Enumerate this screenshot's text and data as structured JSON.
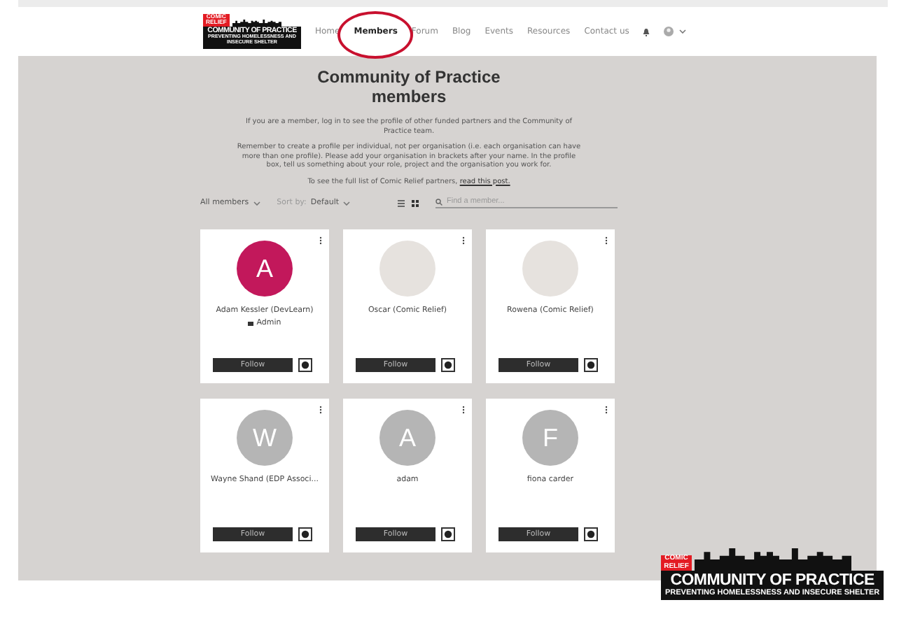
{
  "header": {
    "logo": {
      "badge": "COMIC RELIEF",
      "title": "COMMUNITY OF PRACTICE",
      "subtitle": "PREVENTING HOMELESSNESS AND INSECURE SHELTER"
    },
    "nav": [
      {
        "label": "Home",
        "selected": false
      },
      {
        "label": "Members",
        "selected": true
      },
      {
        "label": "Forum",
        "selected": false
      },
      {
        "label": "Blog",
        "selected": false
      },
      {
        "label": "Events",
        "selected": false
      },
      {
        "label": "Resources",
        "selected": false
      },
      {
        "label": "Contact us",
        "selected": false
      }
    ]
  },
  "content": {
    "title": "Community of Practice members",
    "paragraphs": [
      "If you are a member, log in to see the profile of other funded partners and the Community of Practice team.",
      "Remember to create a profile per individual, not per organisation (i.e. each organisation can have more than one profile). Please add your organisation in brackets after your name. In the profile box, tell us something about your role, project and the organisation you work for."
    ],
    "link_sentence": "To see the full list of Comic Relief partners,",
    "link": "read this post.",
    "filter": "All members",
    "sort_label": "Sort by:",
    "sort_value": "Default",
    "search": {
      "placeholder": "Find a member..."
    },
    "members": [
      {
        "name": "Adam Kessler (DevLearn)",
        "role": "Admin",
        "avatar": {
          "kind": "initial",
          "letter": "A",
          "color": "#c2185b"
        },
        "follow": "Follow"
      },
      {
        "name": "Oscar (Comic Relief)",
        "avatar": {
          "kind": "photo"
        },
        "follow": "Follow"
      },
      {
        "name": "Rowena (Comic Relief)",
        "avatar": {
          "kind": "photo"
        },
        "follow": "Follow"
      },
      {
        "name": "Wayne Shand (EDP Associ...",
        "avatar": {
          "kind": "initial",
          "letter": "W",
          "color": "#b5b5b5"
        },
        "follow": "Follow"
      },
      {
        "name": "adam",
        "avatar": {
          "kind": "initial",
          "letter": "A",
          "color": "#b5b5b5"
        },
        "follow": "Follow"
      },
      {
        "name": "fiona carder",
        "avatar": {
          "kind": "initial",
          "letter": "F",
          "color": "#b5b5b5"
        },
        "follow": "Follow"
      }
    ]
  },
  "overlay_logo": {
    "badge": "COMIC RELIEF",
    "title": "COMMUNITY OF PRACTICE",
    "subtitle": "PREVENTING HOMELESSNESS AND INSECURE SHELTER"
  }
}
